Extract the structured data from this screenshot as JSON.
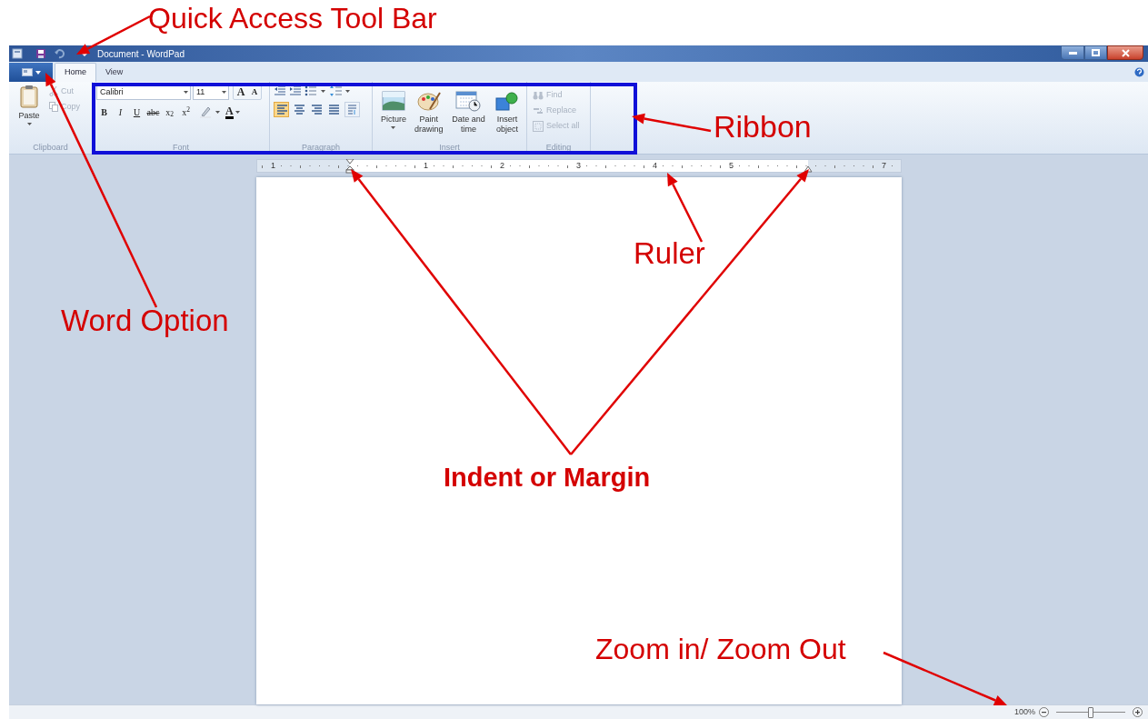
{
  "annotations": [
    {
      "kind": "toolbar",
      "text": "Quick Access Tool Bar"
    },
    {
      "kind": "option",
      "text": "Word Option"
    },
    {
      "kind": "ribbon",
      "text": "Ribbon"
    },
    {
      "kind": "ruler",
      "text": "Ruler"
    },
    {
      "kind": "margin",
      "text": "Indent or Margin"
    },
    {
      "kind": "zoom",
      "text": "Zoom in/ Zoom Out"
    }
  ],
  "window": {
    "title": "Document - WordPad"
  },
  "tabs": [
    {
      "label": "Home",
      "selected": true
    },
    {
      "label": "View",
      "selected": false
    }
  ],
  "ribbon": {
    "clipboard": {
      "label": "Clipboard",
      "items": [
        {
          "label": "Paste",
          "disabled": false
        },
        {
          "label": "Cut",
          "disabled": true
        },
        {
          "label": "Copy",
          "disabled": true
        }
      ]
    },
    "font": {
      "label": "Font",
      "family": "Calibri",
      "size": "11",
      "grow": "A",
      "shrink": "A",
      "styles": [
        "B",
        "I",
        "U",
        "abc",
        "x$_{2}$",
        "x$^{2}$"
      ],
      "color_button": "A"
    },
    "paragraph": {
      "label": "Paragraph",
      "alignments": [
        {
          "selected": true
        },
        {
          "selected": false
        },
        {
          "selected": false
        },
        {
          "selected": false
        }
      ]
    },
    "insert": {
      "label": "Insert",
      "items": [
        "Picture",
        "Paint drawing",
        "Date and time",
        "Insert object"
      ]
    },
    "editing": {
      "label": "Editing",
      "items": [
        {
          "label": "Find",
          "disabled": true
        },
        {
          "label": "Replace",
          "disabled": true
        },
        {
          "label": "Select all",
          "disabled": true
        }
      ]
    }
  },
  "ruler": {
    "labels": [
      "1",
      "1",
      "2",
      "3",
      "4",
      "5",
      "7"
    ]
  },
  "status_bar": {
    "zoom": "100%",
    "level": 0.5
  }
}
